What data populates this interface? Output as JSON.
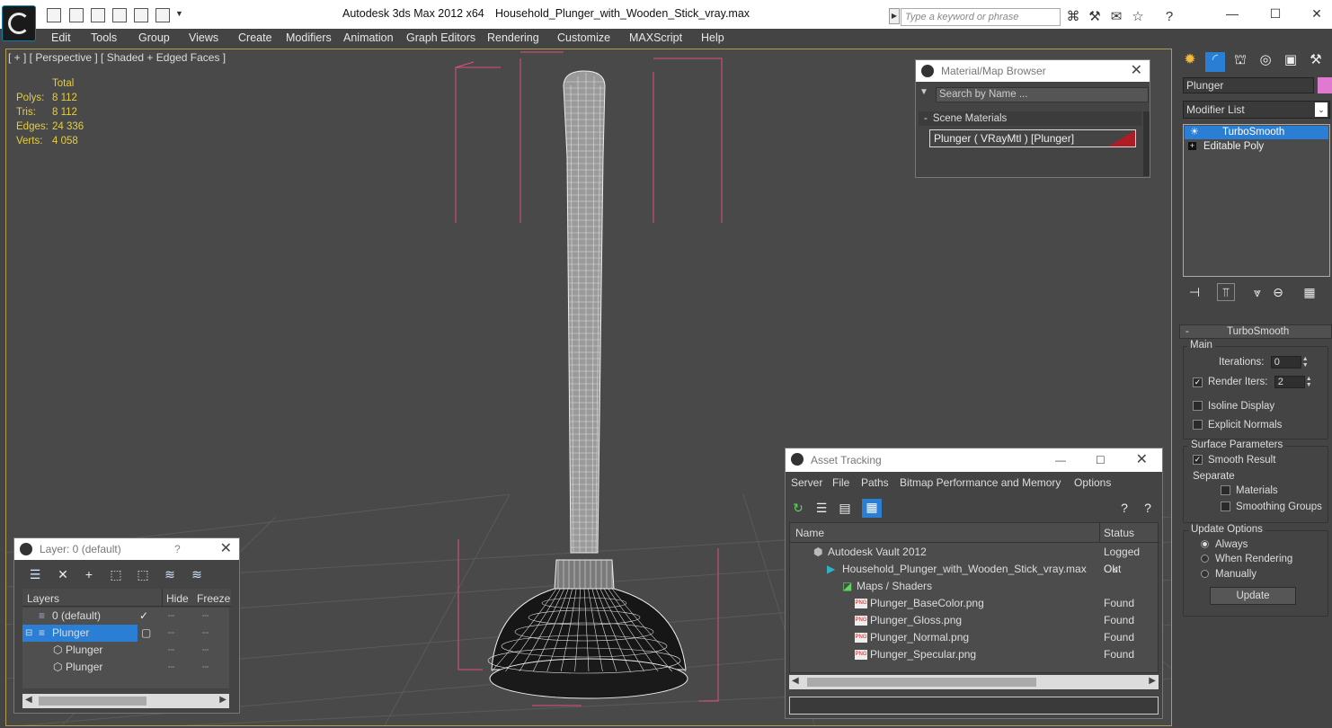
{
  "window": {
    "app_title": "Autodesk 3ds Max  2012 x64",
    "file_title": "Household_Plunger_with_Wooden_Stick_vray.max",
    "search_placeholder": "Type a keyword or phrase"
  },
  "menu": [
    "Edit",
    "Tools",
    "Group",
    "Views",
    "Create",
    "Modifiers",
    "Animation",
    "Graph Editors",
    "Rendering",
    "Customize",
    "MAXScript",
    "Help"
  ],
  "viewport": {
    "label": "[ + ] [ Perspective ] [ Shaded + Edged Faces ]",
    "stats_header": "Total",
    "stats": [
      {
        "label": "Polys:",
        "value": "8 112"
      },
      {
        "label": "Tris:",
        "value": "8 112"
      },
      {
        "label": "Edges:",
        "value": "24 336"
      },
      {
        "label": "Verts:",
        "value": "4 058"
      }
    ]
  },
  "material_browser": {
    "title": "Material/Map Browser",
    "search_placeholder": "Search by Name ...",
    "section": "Scene Materials",
    "section_toggle": "-",
    "item": "Plunger  ( VRayMtl ) [Plunger]"
  },
  "layer_window": {
    "title": "Layer: 0 (default)",
    "help": "?",
    "columns": [
      "Layers",
      "Hide",
      "Freeze"
    ],
    "rows": [
      {
        "name": "0 (default)",
        "active": true
      },
      {
        "name": "Plunger",
        "selected": true
      },
      {
        "name": "Plunger"
      },
      {
        "name": "Plunger"
      }
    ]
  },
  "asset_tracking": {
    "title": "Asset Tracking",
    "menu": [
      "Server",
      "File",
      "Paths",
      "Bitmap Performance and Memory",
      "Options"
    ],
    "columns": [
      "Name",
      "Status"
    ],
    "rows": [
      {
        "name": "Autodesk Vault 2012",
        "status": "Logged Out"
      },
      {
        "name": "Household_Plunger_with_Wooden_Stick_vray.max",
        "status": "Ok"
      },
      {
        "name": "Maps / Shaders",
        "status": ""
      },
      {
        "name": "Plunger_BaseColor.png",
        "status": "Found"
      },
      {
        "name": "Plunger_Gloss.png",
        "status": "Found"
      },
      {
        "name": "Plunger_Normal.png",
        "status": "Found"
      },
      {
        "name": "Plunger_Specular.png",
        "status": "Found"
      }
    ]
  },
  "command_panel": {
    "object_name": "Plunger",
    "modifier_list": "Modifier List",
    "stack": [
      "TurboSmooth",
      "Editable Poly"
    ],
    "rollout_title": "TurboSmooth",
    "rollout_toggle": "-",
    "main_label": "Main",
    "iterations_label": "Iterations:",
    "iterations_value": "0",
    "render_iters_label": "Render Iters:",
    "render_iters_value": "2",
    "isoline_label": "Isoline Display",
    "explicit_normals_label": "Explicit Normals",
    "surface_params_label": "Surface Parameters",
    "smooth_result_label": "Smooth Result",
    "separate_label": "Separate",
    "materials_label": "Materials",
    "smoothing_groups_label": "Smoothing Groups",
    "update_options_label": "Update Options",
    "always_label": "Always",
    "when_rendering_label": "When Rendering",
    "manually_label": "Manually",
    "update_button": "Update"
  },
  "colors": {
    "selection_blue": "#2a7fd4",
    "stats_yellow": "#e6cf3c",
    "bbox_pink": "#e0507a",
    "object_swatch": "#e07ad0"
  }
}
